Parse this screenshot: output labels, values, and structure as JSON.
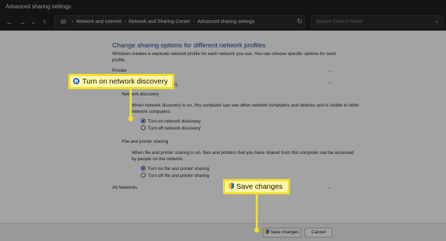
{
  "window": {
    "title": "Advanced sharing settings"
  },
  "address": {
    "crumbs": [
      "Network and Internet",
      "Network and Sharing Center",
      "Advanced sharing settings"
    ],
    "separator": "›",
    "search_placeholder": "Search Control Panel"
  },
  "panel": {
    "title": "Change sharing options for different network profiles",
    "description": "Windows creates a separate network profile for each network you use. You can choose specific options for each profile."
  },
  "profiles": {
    "private": "Private",
    "current_fragment": "rofile)",
    "all_networks": "All Networks"
  },
  "discovery": {
    "heading": "Network discovery",
    "description": "When network discovery is on, this computer can see other network computers and devices and is visible to other network computers.",
    "on_label": "Turn on network discovery",
    "off_label": "Turn off network discovery",
    "selected": "on"
  },
  "sharing": {
    "heading": "File and printer sharing",
    "description": "When file and printer sharing is on, files and printers that you have shared from this computer can be accessed by people on the network.",
    "on_label": "Turn on file and printer sharing",
    "off_label": "Turn off file and printer sharing",
    "selected": "on"
  },
  "buttons": {
    "save": "Save changes",
    "cancel": "Cancel"
  },
  "callouts": {
    "discovery": "Turn on network discovery",
    "save": "Save changes"
  },
  "colors": {
    "accent": "#1a56c8",
    "callout_fill": "#fff7a8",
    "callout_border": "#f2de2a",
    "title_blue": "#1e3c8c"
  }
}
